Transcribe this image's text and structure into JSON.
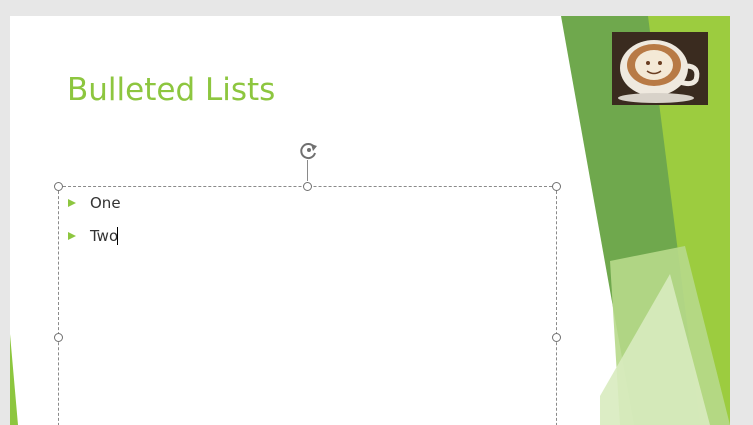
{
  "slide": {
    "title": "Bulleted Lists",
    "bullets": [
      "One",
      "Two"
    ]
  },
  "colors": {
    "accent": "#8dc63f",
    "accent_dark": "#6aa52c",
    "title": "#8dc63f",
    "text": "#333333"
  },
  "icons": {
    "rotate": "rotate-handle-icon",
    "bullet": "triangle-bullet-icon"
  }
}
